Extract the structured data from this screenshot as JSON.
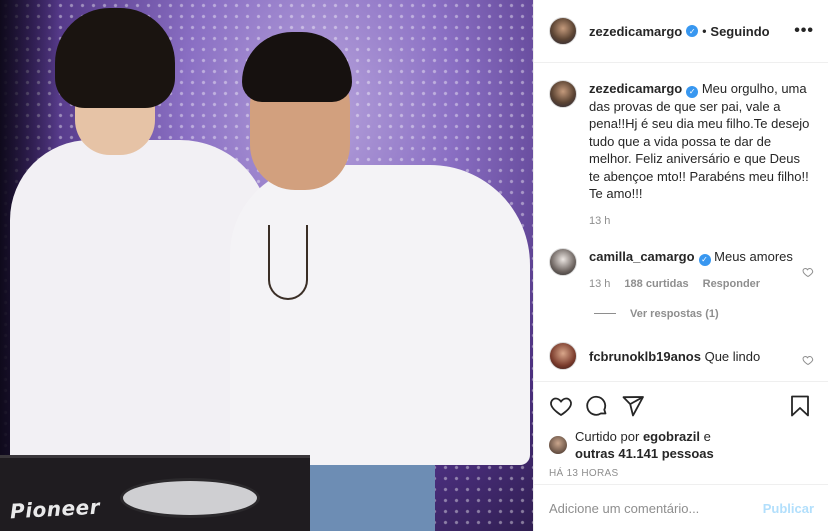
{
  "post": {
    "author": "zezedicamargo",
    "follow_status": "Seguindo",
    "separator": "•",
    "more_icon": "more-horizontal-icon",
    "verified_icon": "verified-badge-icon"
  },
  "caption": {
    "author": "zezedicamargo",
    "text": "Meu orgulho, uma das provas de que ser pai, vale a pena!!Hj é seu dia meu filho.Te desejo tudo que a vida possa te dar de melhor. Feliz aniversário e que Deus te abençoe mto!! Parabéns meu filho!! Te amo!!!",
    "time": "13 h"
  },
  "comments": [
    {
      "author": "camilla_camargo",
      "verified": true,
      "text": "Meus amores",
      "time": "13 h",
      "likes": "188 curtidas",
      "reply_label": "Responder",
      "view_replies": "Ver respostas (1)"
    },
    {
      "author": "fcbrunoklb19anos",
      "verified": false,
      "text": "Que lindo"
    }
  ],
  "actions": {
    "icons": [
      "heart-icon",
      "comment-icon",
      "share-icon",
      "bookmark-icon"
    ]
  },
  "likes": {
    "prefix": "Curtido por",
    "user": "egobrazil",
    "connector": "e",
    "others": "outras 41.141 pessoas"
  },
  "timestamp": "HÁ 13 HORAS",
  "add_comment": {
    "placeholder": "Adicione um comentário...",
    "publish_label": "Publicar"
  },
  "photo": {
    "brand_text": "Pioneer"
  },
  "colors": {
    "accent": "#3897f0",
    "publish_disabled": "#b2dffc",
    "muted": "#8e8e8e",
    "text": "#262626"
  }
}
